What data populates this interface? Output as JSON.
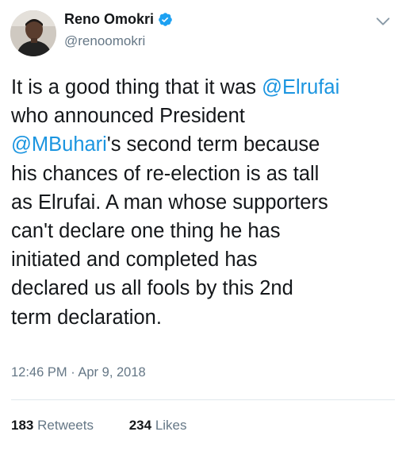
{
  "author": {
    "name": "Reno Omokri",
    "handle": "@renoomokri",
    "avatar": "profile-photo",
    "verified_icon": "verified-badge-icon"
  },
  "tweet": {
    "lines": [
      [
        {
          "text": "It is a good thing that it was "
        },
        {
          "text": "@Elrufai",
          "mention": true
        }
      ],
      [
        {
          "text": "who announced President"
        }
      ],
      [
        {
          "text": "@MBuhari",
          "mention": true
        },
        {
          "text": "'s second term because"
        }
      ],
      [
        {
          "text": "his chances of re-election is as tall"
        }
      ],
      [
        {
          "text": "as Elrufai. A man whose supporters"
        }
      ],
      [
        {
          "text": "can't declare one thing he has"
        }
      ],
      [
        {
          "text": "initiated and completed has"
        }
      ],
      [
        {
          "text": "declared us all fools by this 2nd"
        }
      ],
      [
        {
          "text": "term declaration."
        }
      ]
    ]
  },
  "timestamp": "12:46 PM · Apr 9, 2018",
  "stats": {
    "retweets_count": "183",
    "retweets_label": "Retweets",
    "likes_count": "234",
    "likes_label": "Likes"
  },
  "colors": {
    "text": "#14171a",
    "secondary": "#657786",
    "link": "#1b95e0",
    "verified": "#1da1f2",
    "divider": "#e1e8ed"
  }
}
